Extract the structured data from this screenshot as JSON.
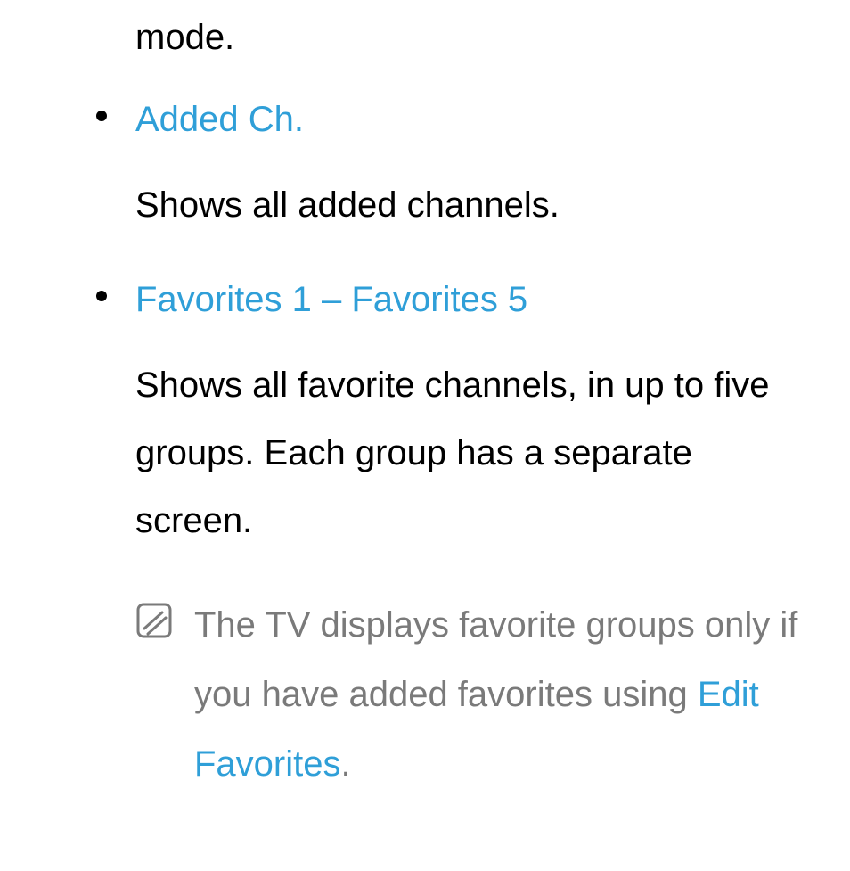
{
  "colors": {
    "link": "#2f9fd8",
    "text": "#000000",
    "muted": "#7a7a7a"
  },
  "partial_top": "mode.",
  "items": [
    {
      "title": "Added Ch.",
      "desc": "Shows all added channels."
    },
    {
      "title": "Favorites 1 – Favorites 5",
      "desc": "Shows all favorite channels, in up to five groups. Each group has a separate screen.",
      "note": {
        "text_prefix": "The TV displays favorite groups only if you have added favorites using ",
        "link_text": "Edit Favorites",
        "text_suffix": "."
      }
    }
  ]
}
